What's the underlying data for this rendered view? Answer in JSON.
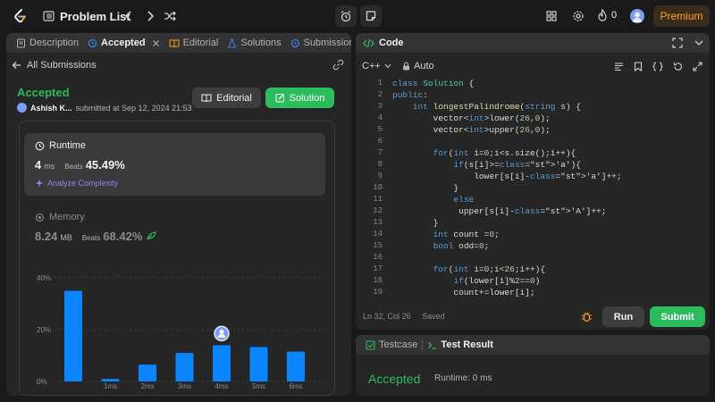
{
  "topbar": {
    "problem_list_label": "Problem List",
    "streak_count": "0",
    "premium_label": "Premium"
  },
  "left_tabs": [
    {
      "label": "Description"
    },
    {
      "label": "Accepted"
    },
    {
      "label": "Editorial"
    },
    {
      "label": "Solutions"
    },
    {
      "label": "Submissions"
    }
  ],
  "submission": {
    "back_label": "All Submissions",
    "status": "Accepted",
    "user": "Ashish K...",
    "submitted_at": "submitted at Sep 12, 2024 21:53",
    "editorial_btn": "Editorial",
    "solution_btn": "Solution"
  },
  "runtime": {
    "heading": "Runtime",
    "value": "4",
    "unit": "ms",
    "beats_label": "Beats",
    "beats_pct": "45.49%",
    "analyze_label": "Analyze Complexity"
  },
  "memory": {
    "heading": "Memory",
    "value": "8.24",
    "unit": "MB",
    "beats_label": "Beats",
    "beats_pct": "68.42%"
  },
  "chart_data": {
    "type": "bar",
    "categories": [
      "",
      "1ms",
      "2ms",
      "3ms",
      "4ms",
      "5ms",
      "6ms"
    ],
    "values": [
      35,
      1,
      6.5,
      11,
      14,
      13.3,
      11.5
    ],
    "highlight_index": 4,
    "y_ticks": [
      "40%",
      "20%",
      "0%"
    ],
    "ylim": [
      0,
      40
    ],
    "bar_color": "#0a84ff"
  },
  "code": {
    "title": "Code",
    "language": "C++",
    "mode": "Auto",
    "cursor": "Ln 32, Col 26",
    "saved": "Saved",
    "run_btn": "Run",
    "submit_btn": "Submit",
    "lines": [
      {
        "n": "1",
        "t": "class Solution {"
      },
      {
        "n": "2",
        "t": "public:"
      },
      {
        "n": "3",
        "t": "    int longestPalindrome(string s) {"
      },
      {
        "n": "4",
        "t": "        vector<int>lower(26,0);"
      },
      {
        "n": "5",
        "t": "        vector<int>upper(26,0);"
      },
      {
        "n": "6",
        "t": ""
      },
      {
        "n": "7",
        "t": "        for(int i=0;i<s.size();i++){"
      },
      {
        "n": "8",
        "t": "            if(s[i]>='a'){"
      },
      {
        "n": "9",
        "t": "                lower[s[i]-'a']++;"
      },
      {
        "n": "10",
        "t": "            }"
      },
      {
        "n": "11",
        "t": "            else"
      },
      {
        "n": "12",
        "t": "             upper[s[i]-'A']++;"
      },
      {
        "n": "13",
        "t": "        }"
      },
      {
        "n": "14",
        "t": "        int count =0;"
      },
      {
        "n": "15",
        "t": "        bool odd=0;"
      },
      {
        "n": "16",
        "t": ""
      },
      {
        "n": "17",
        "t": "        for(int i=0;i<26;i++){"
      },
      {
        "n": "18",
        "t": "            if(lower[i]%2==0)"
      },
      {
        "n": "19",
        "t": "            count+=lower[i];"
      }
    ]
  },
  "test": {
    "tab_testcase": "Testcase",
    "tab_result": "Test Result",
    "status": "Accepted",
    "runtime": "Runtime: 0 ms"
  }
}
